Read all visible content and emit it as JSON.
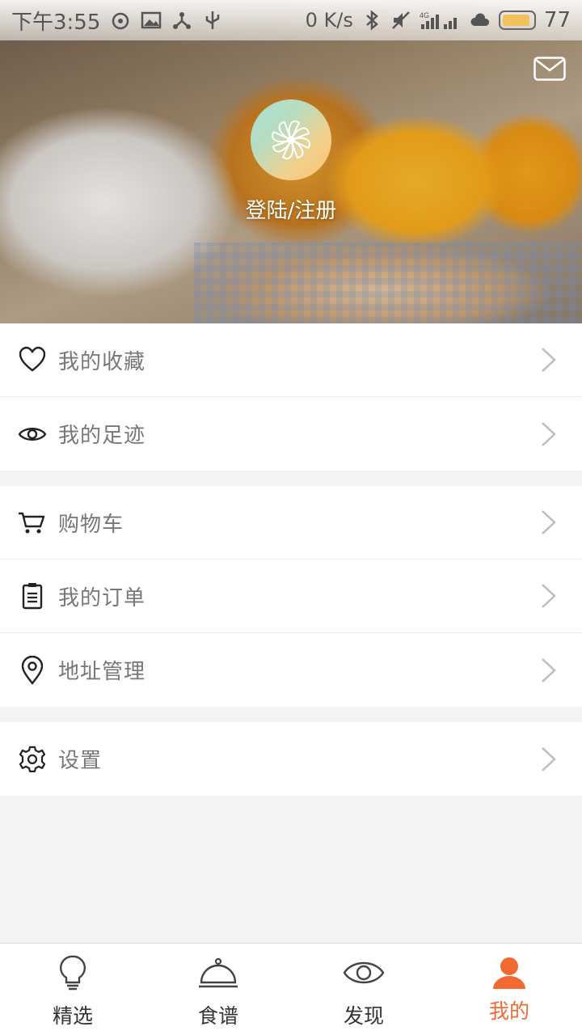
{
  "status_bar": {
    "time": "下午3:55",
    "net_speed": "0 K/s",
    "battery": "77"
  },
  "profile": {
    "login_label": "登陆/注册"
  },
  "menu_groups": [
    {
      "items": [
        {
          "label": "我的收藏",
          "icon": "heart-icon"
        },
        {
          "label": "我的足迹",
          "icon": "eye-icon"
        }
      ]
    },
    {
      "items": [
        {
          "label": "购物车",
          "icon": "cart-icon"
        },
        {
          "label": "我的订单",
          "icon": "clipboard-icon"
        },
        {
          "label": "地址管理",
          "icon": "location-pin-icon"
        }
      ]
    },
    {
      "items": [
        {
          "label": "设置",
          "icon": "gear-icon"
        }
      ]
    }
  ],
  "tabs": [
    {
      "label": "精选",
      "icon": "lightbulb-icon",
      "active": false
    },
    {
      "label": "食谱",
      "icon": "cloche-icon",
      "active": false
    },
    {
      "label": "发现",
      "icon": "eye-icon",
      "active": false
    },
    {
      "label": "我的",
      "icon": "user-icon",
      "active": true
    }
  ],
  "colors": {
    "accent": "#f26a32",
    "background": "#f3f3f3",
    "menu_text": "#777777"
  }
}
